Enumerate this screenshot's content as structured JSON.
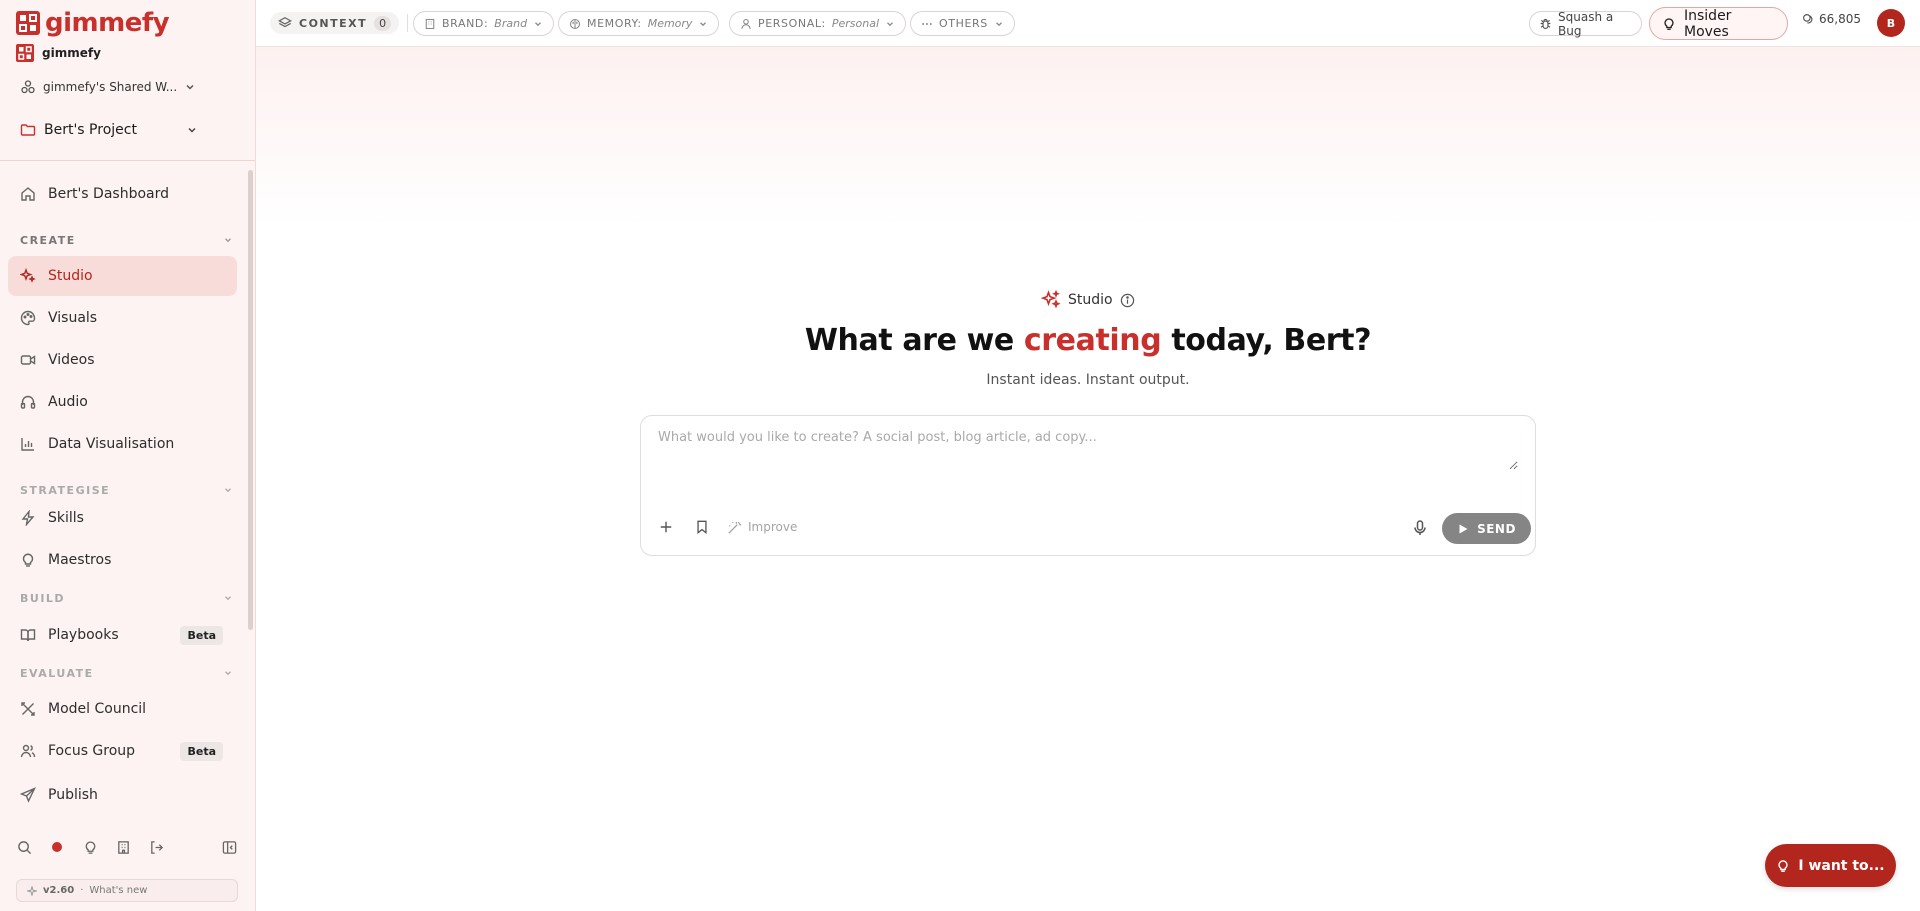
{
  "brand": {
    "logo_text": "gimmefy",
    "accent": "#c9302c"
  },
  "org": {
    "name": "gimmefy"
  },
  "workspace": {
    "name": "gimmefy's Shared W..."
  },
  "project": {
    "name": "Bert's Project"
  },
  "nav": {
    "dashboard": "Bert's Dashboard",
    "create_section": "CREATE",
    "studio": "Studio",
    "visuals": "Visuals",
    "videos": "Videos",
    "audio": "Audio",
    "data_vis": "Data Visualisation",
    "strategise_section": "STRATEGISE",
    "skills": "Skills",
    "maestros": "Maestros",
    "build_section": "BUILD",
    "playbooks": "Playbooks",
    "playbooks_badge": "Beta",
    "evaluate_section": "EVALUATE",
    "model_council": "Model Council",
    "focus_group": "Focus Group",
    "focus_group_badge": "Beta",
    "publish": "Publish"
  },
  "version": {
    "number": "v2.60",
    "separator": "·",
    "whats_new": "What's new"
  },
  "topbar": {
    "context_label": "CONTEXT",
    "context_count": "0",
    "brand_key": "BRAND:",
    "brand_value": "Brand",
    "memory_key": "MEMORY:",
    "memory_value": "Memory",
    "personal_key": "PERSONAL:",
    "personal_value": "Personal",
    "others_label": "OTHERS",
    "bug_label": "Squash a Bug",
    "insider_label": "Insider Moves",
    "credits": "66,805",
    "avatar_initial": "B"
  },
  "main": {
    "studio_tag": "Studio",
    "headline_pre": "What are we ",
    "headline_accent": "creating",
    "headline_post": " today, Bert?",
    "subline": "Instant ideas. Instant output.",
    "prompt_placeholder": "What would you like to create? A social post, blog article, ad copy...",
    "prompt_value": "",
    "improve_label": "Improve",
    "send_label": "SEND",
    "i_want_label": "I want to..."
  }
}
